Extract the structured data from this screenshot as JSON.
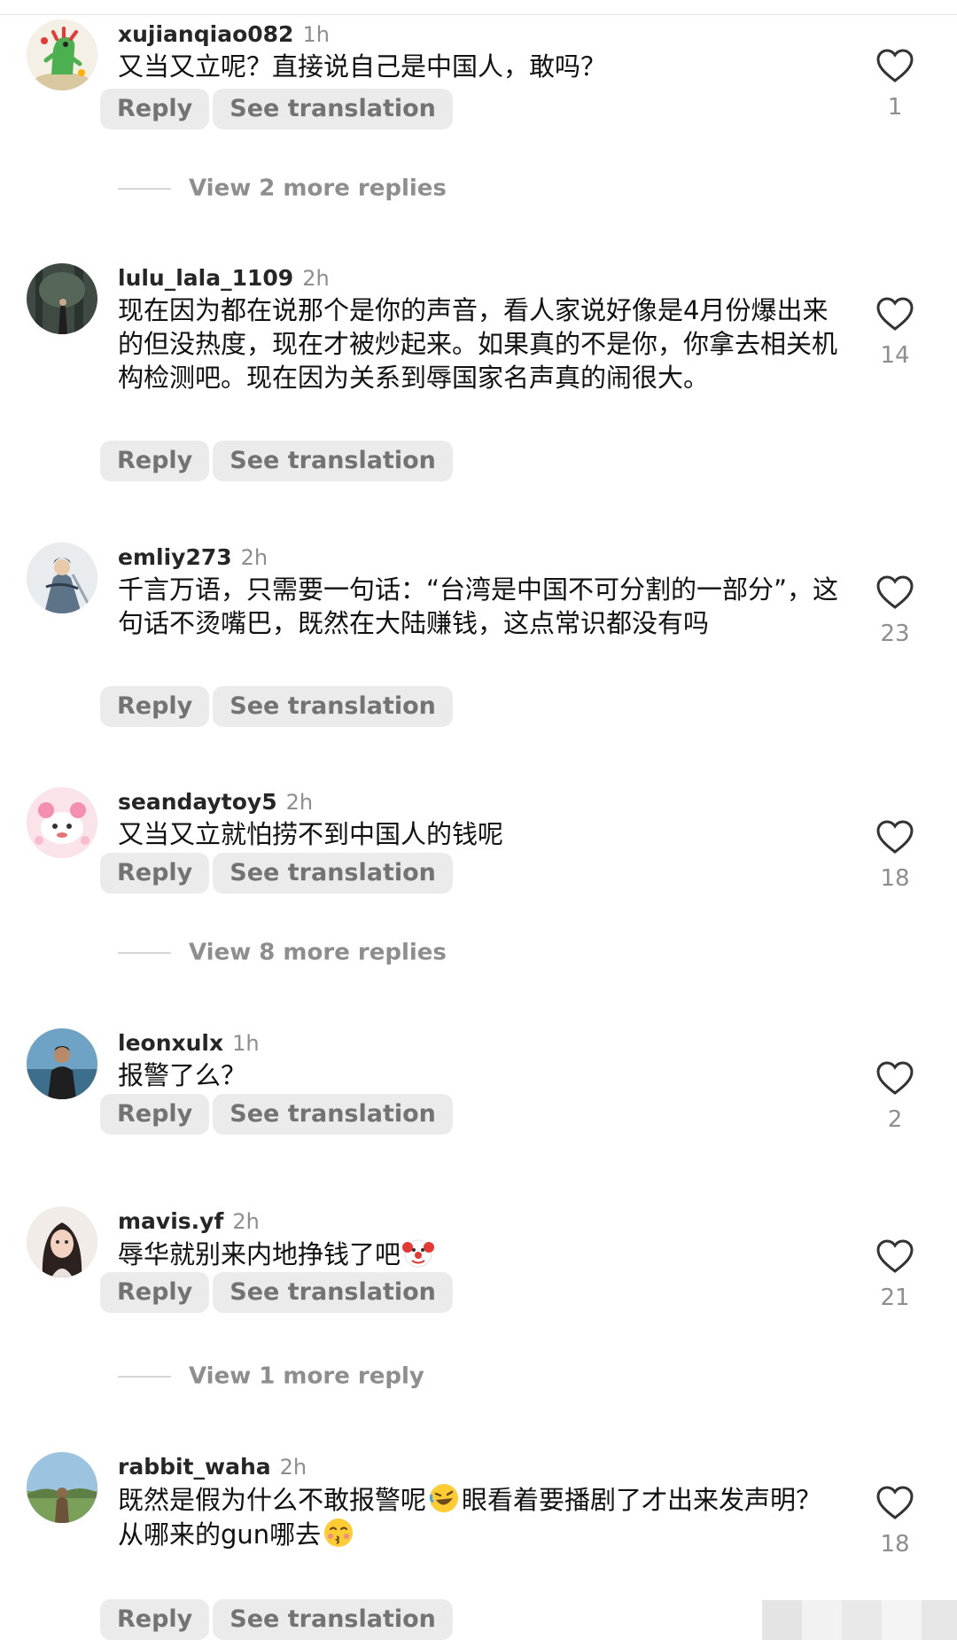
{
  "actions": {
    "reply": "Reply",
    "see_translation": "See translation"
  },
  "comments": [
    {
      "username": "xujianqiao082",
      "time": "1h",
      "text": "又当又立呢？直接说自己是中国人，敢吗？",
      "likes": "1",
      "more_replies": "View 2 more replies",
      "avatar_icon": "dinosaur-avatar"
    },
    {
      "username": "lulu_lala_1109",
      "time": "2h",
      "text": "现在因为都在说那个是你的声音，看人家说好像是4月份爆出来的但没热度，现在才被炒起来。如果真的不是你，你拿去相关机构检测吧。现在因为关系到辱国家名声真的闹很大。",
      "likes": "14",
      "avatar_icon": "forest-avatar"
    },
    {
      "username": "emliy273",
      "time": "2h",
      "text": "千言万语，只需要一句话：“台湾是中国不可分割的一部分”，这句话不烫嘴巴，既然在大陆赚钱，这点常识都没有吗",
      "likes": "23",
      "avatar_icon": "swordsman-avatar"
    },
    {
      "username": "seandaytoy5",
      "time": "2h",
      "text": "又当又立就怕捞不到中国人的钱呢",
      "likes": "18",
      "more_replies": "View 8 more replies",
      "avatar_icon": "pink-cartoon-avatar"
    },
    {
      "username": "leonxulx",
      "time": "1h",
      "text": "报警了么？",
      "likes": "2",
      "avatar_icon": "beach-person-avatar"
    },
    {
      "username": "mavis.yf",
      "time": "2h",
      "text_parts": [
        "辱华就别来内地挣钱了吧"
      ],
      "likes": "21",
      "more_replies": "View 1 more reply",
      "avatar_icon": "selfie-avatar",
      "emoji": [
        "clown-face-emoji"
      ]
    },
    {
      "username": "rabbit_waha",
      "time": "2h",
      "text_parts": [
        "既然是假为什么不敢报警呢",
        "眼看着要播剧了才出来发声明？从哪来的gun哪去"
      ],
      "likes": "18",
      "avatar_icon": "landscape-avatar",
      "emoji": [
        "rolling-laughing-emoji",
        "kissing-face-emoji"
      ]
    }
  ],
  "colors": {
    "text": "#111111",
    "username": "#262626",
    "secondary": "#8e8e8e",
    "pill_bg": "#ebebeb",
    "pill_text": "#737373"
  }
}
